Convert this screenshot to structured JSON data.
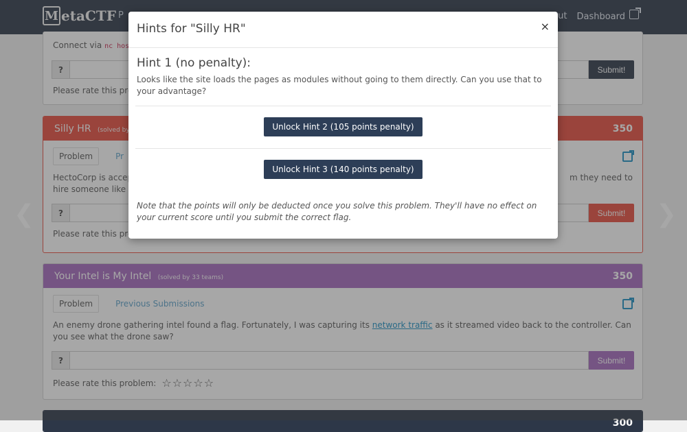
{
  "navbar": {
    "brand_letter": "M",
    "brand_rest": "etaCTF",
    "left_fragment": "P",
    "right_fragment": "ut",
    "dashboard_label": "Dashboard"
  },
  "top_panel": {
    "connect_text": "Connect via",
    "connect_code": "nc host",
    "flag_prefix": "?",
    "submit_label": "Submit!",
    "rate_label": "Please rate this problem:"
  },
  "panels": [
    {
      "title": "Silly HR",
      "solved": "(solved by",
      "points": "350",
      "color": "#e74c3c",
      "tab_problem": "Problem",
      "tab_submissions": "Pr",
      "desc": "HectoCorp is accep",
      "desc2": "hire someone like y",
      "desc_right": "m they need to",
      "flag_prefix": "?",
      "submit_label": "Submit!",
      "rate_label": "Please rate this problem:"
    },
    {
      "title": "Your Intel is My Intel",
      "solved": "(solved by 33 teams)",
      "points": "350",
      "color": "#a569bd",
      "tab_problem": "Problem",
      "tab_submissions": "Previous Submissions",
      "desc_before": "An enemy drone gathering intel found a flag. Fortunately, I was capturing its ",
      "desc_link": "network traffic",
      "desc_after": " as it streamed video back to the controller. Can you see what the drone saw?",
      "flag_prefix": "?",
      "submit_label": "Submit!",
      "rate_label": "Please rate this problem:",
      "stars": "☆☆☆☆☆"
    }
  ],
  "bottom_panel": {
    "points": "300"
  },
  "carousel": {
    "prev": "❮",
    "next": "❯"
  },
  "modal": {
    "title": "Hints for \"Silly HR\"",
    "close": "×",
    "hint1_title": "Hint 1 (no penalty):",
    "hint1_text": "Looks like the site loads the pages as modules without going to them directly. Can you use that to your advantage?",
    "unlock2_label": "Unlock Hint 2 (105 points penalty)",
    "unlock3_label": "Unlock Hint 3 (140 points penalty)",
    "note": "Note that the points will only be deducted once you solve this problem. They'll have no effect on your current score until you submit the correct flag."
  },
  "colors": {
    "navbar": "#2d3748",
    "silly_hr": "#e74c3c",
    "intel": "#a569bd",
    "submit_dark": "#2d3748",
    "unlock_button": "#2d3e57"
  }
}
